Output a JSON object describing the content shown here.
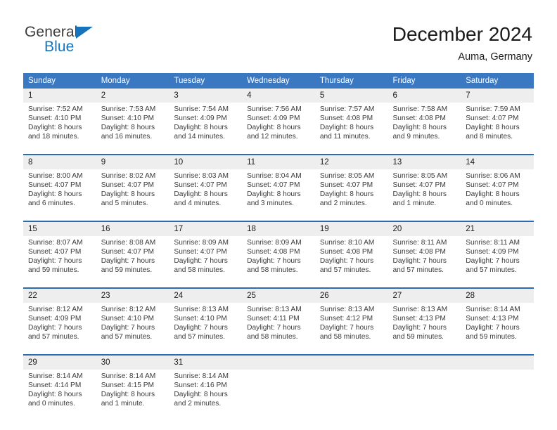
{
  "brand": {
    "name_top": "General",
    "name_bottom": "Blue",
    "triangle_icon": "blue-triangle-icon",
    "color_dark": "#3c3c3c",
    "color_blue": "#1574bb"
  },
  "header": {
    "title": "December 2024",
    "subtitle": "Auma, Germany"
  },
  "colors": {
    "header_blue": "#3b78c2",
    "row_divider_blue": "#2b6cb0",
    "daynum_band": "#eeeeee",
    "text": "#3a3a3a"
  },
  "weekday_headers": [
    "Sunday",
    "Monday",
    "Tuesday",
    "Wednesday",
    "Thursday",
    "Friday",
    "Saturday"
  ],
  "weeks": [
    {
      "days": [
        {
          "number": "1",
          "sunrise": "Sunrise: 7:52 AM",
          "sunset": "Sunset: 4:10 PM",
          "daylight_1": "Daylight: 8 hours",
          "daylight_2": "and 18 minutes."
        },
        {
          "number": "2",
          "sunrise": "Sunrise: 7:53 AM",
          "sunset": "Sunset: 4:10 PM",
          "daylight_1": "Daylight: 8 hours",
          "daylight_2": "and 16 minutes."
        },
        {
          "number": "3",
          "sunrise": "Sunrise: 7:54 AM",
          "sunset": "Sunset: 4:09 PM",
          "daylight_1": "Daylight: 8 hours",
          "daylight_2": "and 14 minutes."
        },
        {
          "number": "4",
          "sunrise": "Sunrise: 7:56 AM",
          "sunset": "Sunset: 4:09 PM",
          "daylight_1": "Daylight: 8 hours",
          "daylight_2": "and 12 minutes."
        },
        {
          "number": "5",
          "sunrise": "Sunrise: 7:57 AM",
          "sunset": "Sunset: 4:08 PM",
          "daylight_1": "Daylight: 8 hours",
          "daylight_2": "and 11 minutes."
        },
        {
          "number": "6",
          "sunrise": "Sunrise: 7:58 AM",
          "sunset": "Sunset: 4:08 PM",
          "daylight_1": "Daylight: 8 hours",
          "daylight_2": "and 9 minutes."
        },
        {
          "number": "7",
          "sunrise": "Sunrise: 7:59 AM",
          "sunset": "Sunset: 4:07 PM",
          "daylight_1": "Daylight: 8 hours",
          "daylight_2": "and 8 minutes."
        }
      ]
    },
    {
      "days": [
        {
          "number": "8",
          "sunrise": "Sunrise: 8:00 AM",
          "sunset": "Sunset: 4:07 PM",
          "daylight_1": "Daylight: 8 hours",
          "daylight_2": "and 6 minutes."
        },
        {
          "number": "9",
          "sunrise": "Sunrise: 8:02 AM",
          "sunset": "Sunset: 4:07 PM",
          "daylight_1": "Daylight: 8 hours",
          "daylight_2": "and 5 minutes."
        },
        {
          "number": "10",
          "sunrise": "Sunrise: 8:03 AM",
          "sunset": "Sunset: 4:07 PM",
          "daylight_1": "Daylight: 8 hours",
          "daylight_2": "and 4 minutes."
        },
        {
          "number": "11",
          "sunrise": "Sunrise: 8:04 AM",
          "sunset": "Sunset: 4:07 PM",
          "daylight_1": "Daylight: 8 hours",
          "daylight_2": "and 3 minutes."
        },
        {
          "number": "12",
          "sunrise": "Sunrise: 8:05 AM",
          "sunset": "Sunset: 4:07 PM",
          "daylight_1": "Daylight: 8 hours",
          "daylight_2": "and 2 minutes."
        },
        {
          "number": "13",
          "sunrise": "Sunrise: 8:05 AM",
          "sunset": "Sunset: 4:07 PM",
          "daylight_1": "Daylight: 8 hours",
          "daylight_2": "and 1 minute."
        },
        {
          "number": "14",
          "sunrise": "Sunrise: 8:06 AM",
          "sunset": "Sunset: 4:07 PM",
          "daylight_1": "Daylight: 8 hours",
          "daylight_2": "and 0 minutes."
        }
      ]
    },
    {
      "days": [
        {
          "number": "15",
          "sunrise": "Sunrise: 8:07 AM",
          "sunset": "Sunset: 4:07 PM",
          "daylight_1": "Daylight: 7 hours",
          "daylight_2": "and 59 minutes."
        },
        {
          "number": "16",
          "sunrise": "Sunrise: 8:08 AM",
          "sunset": "Sunset: 4:07 PM",
          "daylight_1": "Daylight: 7 hours",
          "daylight_2": "and 59 minutes."
        },
        {
          "number": "17",
          "sunrise": "Sunrise: 8:09 AM",
          "sunset": "Sunset: 4:07 PM",
          "daylight_1": "Daylight: 7 hours",
          "daylight_2": "and 58 minutes."
        },
        {
          "number": "18",
          "sunrise": "Sunrise: 8:09 AM",
          "sunset": "Sunset: 4:08 PM",
          "daylight_1": "Daylight: 7 hours",
          "daylight_2": "and 58 minutes."
        },
        {
          "number": "19",
          "sunrise": "Sunrise: 8:10 AM",
          "sunset": "Sunset: 4:08 PM",
          "daylight_1": "Daylight: 7 hours",
          "daylight_2": "and 57 minutes."
        },
        {
          "number": "20",
          "sunrise": "Sunrise: 8:11 AM",
          "sunset": "Sunset: 4:08 PM",
          "daylight_1": "Daylight: 7 hours",
          "daylight_2": "and 57 minutes."
        },
        {
          "number": "21",
          "sunrise": "Sunrise: 8:11 AM",
          "sunset": "Sunset: 4:09 PM",
          "daylight_1": "Daylight: 7 hours",
          "daylight_2": "and 57 minutes."
        }
      ]
    },
    {
      "days": [
        {
          "number": "22",
          "sunrise": "Sunrise: 8:12 AM",
          "sunset": "Sunset: 4:09 PM",
          "daylight_1": "Daylight: 7 hours",
          "daylight_2": "and 57 minutes."
        },
        {
          "number": "23",
          "sunrise": "Sunrise: 8:12 AM",
          "sunset": "Sunset: 4:10 PM",
          "daylight_1": "Daylight: 7 hours",
          "daylight_2": "and 57 minutes."
        },
        {
          "number": "24",
          "sunrise": "Sunrise: 8:13 AM",
          "sunset": "Sunset: 4:10 PM",
          "daylight_1": "Daylight: 7 hours",
          "daylight_2": "and 57 minutes."
        },
        {
          "number": "25",
          "sunrise": "Sunrise: 8:13 AM",
          "sunset": "Sunset: 4:11 PM",
          "daylight_1": "Daylight: 7 hours",
          "daylight_2": "and 58 minutes."
        },
        {
          "number": "26",
          "sunrise": "Sunrise: 8:13 AM",
          "sunset": "Sunset: 4:12 PM",
          "daylight_1": "Daylight: 7 hours",
          "daylight_2": "and 58 minutes."
        },
        {
          "number": "27",
          "sunrise": "Sunrise: 8:13 AM",
          "sunset": "Sunset: 4:13 PM",
          "daylight_1": "Daylight: 7 hours",
          "daylight_2": "and 59 minutes."
        },
        {
          "number": "28",
          "sunrise": "Sunrise: 8:14 AM",
          "sunset": "Sunset: 4:13 PM",
          "daylight_1": "Daylight: 7 hours",
          "daylight_2": "and 59 minutes."
        }
      ]
    },
    {
      "days": [
        {
          "number": "29",
          "sunrise": "Sunrise: 8:14 AM",
          "sunset": "Sunset: 4:14 PM",
          "daylight_1": "Daylight: 8 hours",
          "daylight_2": "and 0 minutes."
        },
        {
          "number": "30",
          "sunrise": "Sunrise: 8:14 AM",
          "sunset": "Sunset: 4:15 PM",
          "daylight_1": "Daylight: 8 hours",
          "daylight_2": "and 1 minute."
        },
        {
          "number": "31",
          "sunrise": "Sunrise: 8:14 AM",
          "sunset": "Sunset: 4:16 PM",
          "daylight_1": "Daylight: 8 hours",
          "daylight_2": "and 2 minutes."
        },
        {
          "number": "",
          "sunrise": "",
          "sunset": "",
          "daylight_1": "",
          "daylight_2": ""
        },
        {
          "number": "",
          "sunrise": "",
          "sunset": "",
          "daylight_1": "",
          "daylight_2": ""
        },
        {
          "number": "",
          "sunrise": "",
          "sunset": "",
          "daylight_1": "",
          "daylight_2": ""
        },
        {
          "number": "",
          "sunrise": "",
          "sunset": "",
          "daylight_1": "",
          "daylight_2": ""
        }
      ]
    }
  ]
}
